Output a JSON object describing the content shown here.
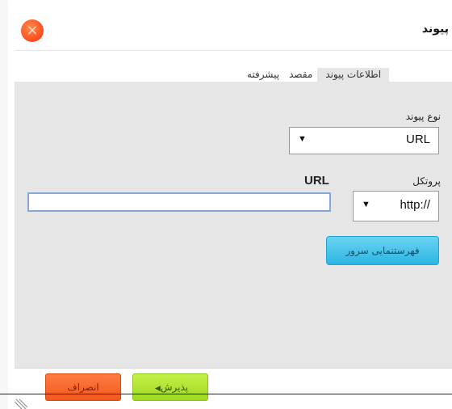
{
  "dialog": {
    "title": "پیوند"
  },
  "tabs": [
    {
      "label": "اطلاعات پیوند",
      "active": true
    },
    {
      "label": "مقصد",
      "active": false
    },
    {
      "label": "پیشرفته",
      "active": false
    }
  ],
  "link_type": {
    "label": "نوع پیوند",
    "value": "URL"
  },
  "protocol": {
    "label": "پروتکل",
    "value": "http://"
  },
  "url": {
    "label": "URL",
    "value": ""
  },
  "buttons": {
    "browse": "فهرستنمایی سرور",
    "ok": "پذیرش",
    "cancel": "انصراف"
  },
  "colors": {
    "close": "#ff4a1f",
    "browse": "#2bb6e4",
    "ok": "#9fd821",
    "cancel": "#f0591c",
    "panel": "#e6e6e6"
  },
  "icons": {
    "close": "close-icon",
    "dropdown": "triangle-down-icon",
    "ok_marker": "triangle-left-icon",
    "resize": "resize-grip-icon"
  }
}
